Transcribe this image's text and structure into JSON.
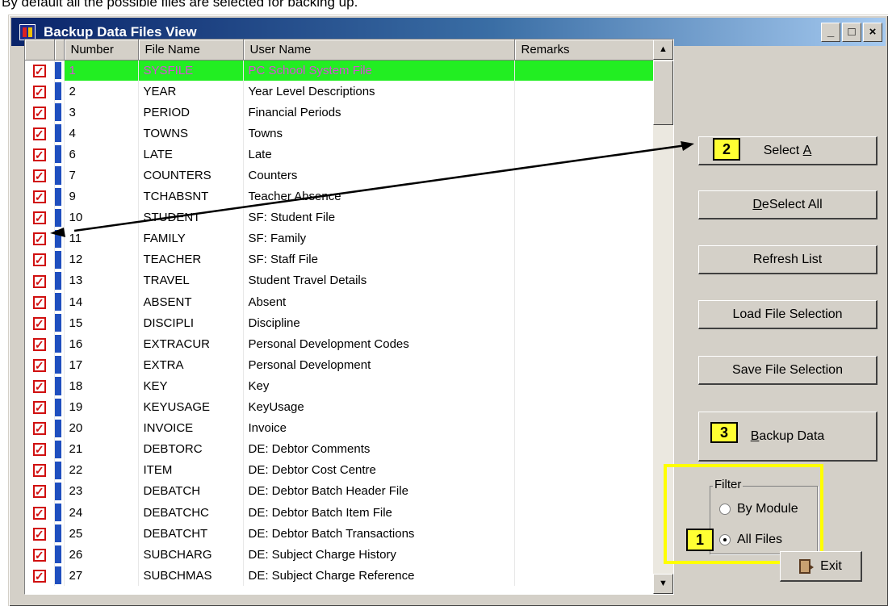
{
  "caption": "By default all the possible files are selected for backing up.",
  "window": {
    "title": "Backup Data Files View",
    "min_glyph": "_",
    "max_glyph": "□",
    "close_glyph": "×"
  },
  "grid": {
    "columns": [
      "",
      "",
      "Number",
      "File Name",
      "User Name",
      "Remarks"
    ],
    "rows": [
      {
        "number": "1",
        "file": "SYSFILE",
        "user": "PC School System File",
        "checked": true
      },
      {
        "number": "2",
        "file": "YEAR",
        "user": "Year Level Descriptions",
        "checked": true
      },
      {
        "number": "3",
        "file": "PERIOD",
        "user": "Financial Periods",
        "checked": true
      },
      {
        "number": "4",
        "file": "TOWNS",
        "user": "Towns",
        "checked": true
      },
      {
        "number": "6",
        "file": "LATE",
        "user": "Late",
        "checked": true
      },
      {
        "number": "7",
        "file": "COUNTERS",
        "user": "Counters",
        "checked": true
      },
      {
        "number": "9",
        "file": "TCHABSNT",
        "user": "Teacher Absence",
        "checked": true
      },
      {
        "number": "10",
        "file": "STUDENT",
        "user": "SF: Student File",
        "checked": true
      },
      {
        "number": "11",
        "file": "FAMILY",
        "user": "SF: Family",
        "checked": true
      },
      {
        "number": "12",
        "file": "TEACHER",
        "user": "SF: Staff File",
        "checked": true
      },
      {
        "number": "13",
        "file": "TRAVEL",
        "user": "Student Travel Details",
        "checked": true
      },
      {
        "number": "14",
        "file": "ABSENT",
        "user": "Absent",
        "checked": true
      },
      {
        "number": "15",
        "file": "DISCIPLI",
        "user": "Discipline",
        "checked": true
      },
      {
        "number": "16",
        "file": "EXTRACUR",
        "user": "Personal Development Codes",
        "checked": true
      },
      {
        "number": "17",
        "file": "EXTRA",
        "user": "Personal Development",
        "checked": true
      },
      {
        "number": "18",
        "file": "KEY",
        "user": "Key",
        "checked": true
      },
      {
        "number": "19",
        "file": "KEYUSAGE",
        "user": "KeyUsage",
        "checked": true
      },
      {
        "number": "20",
        "file": "INVOICE",
        "user": "Invoice",
        "checked": true
      },
      {
        "number": "21",
        "file": "DEBTORC",
        "user": "DE: Debtor Comments",
        "checked": true
      },
      {
        "number": "22",
        "file": "ITEM",
        "user": "DE: Debtor Cost Centre",
        "checked": true
      },
      {
        "number": "23",
        "file": "DEBATCH",
        "user": "DE: Debtor Batch Header File",
        "checked": true
      },
      {
        "number": "24",
        "file": "DEBATCHC",
        "user": "DE: Debtor Batch Item File",
        "checked": true
      },
      {
        "number": "25",
        "file": "DEBATCHT",
        "user": "DE: Debtor Batch Transactions",
        "checked": true
      },
      {
        "number": "26",
        "file": "SUBCHARG",
        "user": "DE: Subject Charge History",
        "checked": true
      },
      {
        "number": "27",
        "file": "SUBCHMAS",
        "user": "DE: Subject Charge Reference",
        "checked": true
      }
    ],
    "check_glyph": "✓",
    "scroll_up_glyph": "▲",
    "scroll_down_glyph": "▼"
  },
  "buttons": {
    "select_all": {
      "key": "A",
      "pre": "Select ",
      "post": ""
    },
    "deselect_all": {
      "key": "D",
      "pre": "",
      "post": "eSelect All"
    },
    "refresh": "Refresh List",
    "load": "Load File Selection",
    "save": "Save File Selection",
    "backup": {
      "key": "B",
      "pre": "",
      "post": "ackup Data"
    },
    "exit": "Exit"
  },
  "filter": {
    "legend": "Filter",
    "by_module": "By Module",
    "all_files": "All Files",
    "selected": "All Files"
  },
  "callouts": {
    "one": "1",
    "two": "2",
    "three": "3"
  },
  "colors": {
    "highlight_row": "#22ee22",
    "highlight_text": "#d84ed8",
    "check": "#d01010",
    "callout": "#ffff33"
  }
}
